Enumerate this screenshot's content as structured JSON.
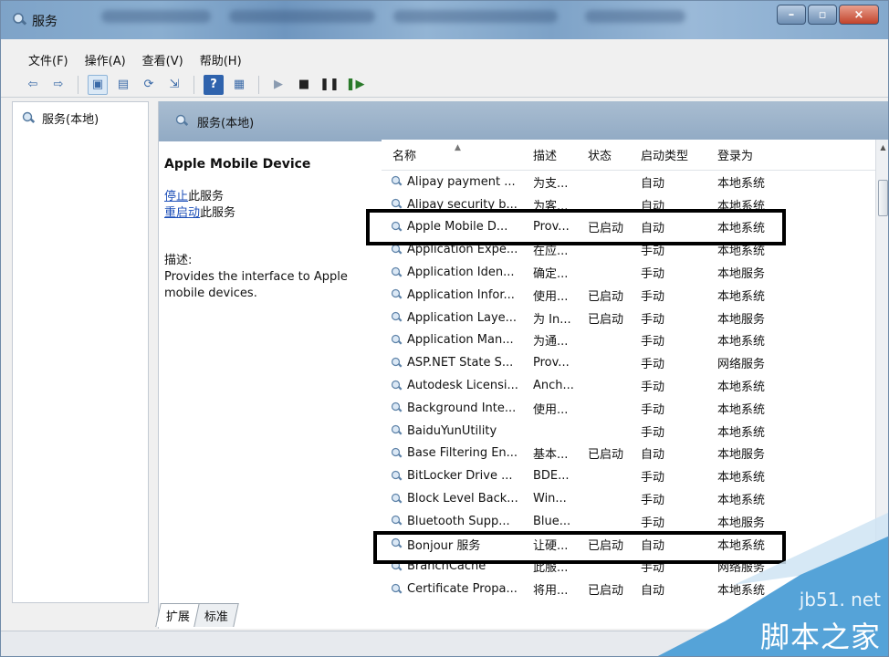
{
  "window": {
    "title": "服务"
  },
  "menu": [
    "文件(F)",
    "操作(A)",
    "查看(V)",
    "帮助(H)"
  ],
  "toolbar": {
    "icons": [
      "back-arrow-icon",
      "forward-arrow-icon",
      "console-tree-icon",
      "properties-icon",
      "refresh-icon",
      "export-icon",
      "help-icon",
      "view-icon",
      "play-icon",
      "stop-icon",
      "pause-icon",
      "restart-icon"
    ]
  },
  "tree": {
    "item_label": "服务(本地)"
  },
  "pane": {
    "header_label": "服务(本地)",
    "selected_service": "Apple Mobile Device",
    "stop_link": "停止",
    "stop_suffix": "此服务",
    "restart_link": "重启动",
    "restart_suffix": "此服务",
    "desc_label": "描述:",
    "desc_text": "Provides the interface to Apple mobile devices."
  },
  "list": {
    "columns": {
      "name": "名称",
      "desc": "描述",
      "state": "状态",
      "startup": "启动类型",
      "logon": "登录为"
    },
    "rows": [
      {
        "name": "Alipay payment ...",
        "desc": "为支...",
        "state": "",
        "startup": "自动",
        "logon": "本地系统"
      },
      {
        "name": "Alipay security b...",
        "desc": "为客...",
        "state": "",
        "startup": "自动",
        "logon": "本地系统"
      },
      {
        "name": "Apple Mobile D...",
        "desc": "Prov...",
        "state": "已启动",
        "startup": "自动",
        "logon": "本地系统"
      },
      {
        "name": "Application Expe...",
        "desc": "在应...",
        "state": "",
        "startup": "手动",
        "logon": "本地系统"
      },
      {
        "name": "Application Iden...",
        "desc": "确定...",
        "state": "",
        "startup": "手动",
        "logon": "本地服务"
      },
      {
        "name": "Application Infor...",
        "desc": "使用...",
        "state": "已启动",
        "startup": "手动",
        "logon": "本地系统"
      },
      {
        "name": "Application Laye...",
        "desc": "为 In...",
        "state": "已启动",
        "startup": "手动",
        "logon": "本地服务"
      },
      {
        "name": "Application Man...",
        "desc": "为通...",
        "state": "",
        "startup": "手动",
        "logon": "本地系统"
      },
      {
        "name": "ASP.NET State S...",
        "desc": "Prov...",
        "state": "",
        "startup": "手动",
        "logon": "网络服务"
      },
      {
        "name": "Autodesk Licensi...",
        "desc": "Anch...",
        "state": "",
        "startup": "手动",
        "logon": "本地系统"
      },
      {
        "name": "Background Inte...",
        "desc": "使用...",
        "state": "",
        "startup": "手动",
        "logon": "本地系统"
      },
      {
        "name": "BaiduYunUtility",
        "desc": "",
        "state": "",
        "startup": "手动",
        "logon": "本地系统"
      },
      {
        "name": "Base Filtering En...",
        "desc": "基本...",
        "state": "已启动",
        "startup": "自动",
        "logon": "本地服务"
      },
      {
        "name": "BitLocker Drive ...",
        "desc": "BDE...",
        "state": "",
        "startup": "手动",
        "logon": "本地系统"
      },
      {
        "name": "Block Level Back...",
        "desc": "Win...",
        "state": "",
        "startup": "手动",
        "logon": "本地系统"
      },
      {
        "name": "Bluetooth Supp...",
        "desc": "Blue...",
        "state": "",
        "startup": "手动",
        "logon": "本地服务"
      },
      {
        "name": "Bonjour 服务",
        "desc": "让硬...",
        "state": "已启动",
        "startup": "自动",
        "logon": "本地系统"
      },
      {
        "name": "BranchCache",
        "desc": "此服...",
        "state": "",
        "startup": "手动",
        "logon": "网络服务"
      },
      {
        "name": "Certificate Propa...",
        "desc": "将用...",
        "state": "已启动",
        "startup": "自动",
        "logon": "本地系统"
      }
    ]
  },
  "tabs": [
    "扩展",
    "标准"
  ],
  "watermark": {
    "line1": "jb51. net",
    "line2": "脚本之家"
  }
}
